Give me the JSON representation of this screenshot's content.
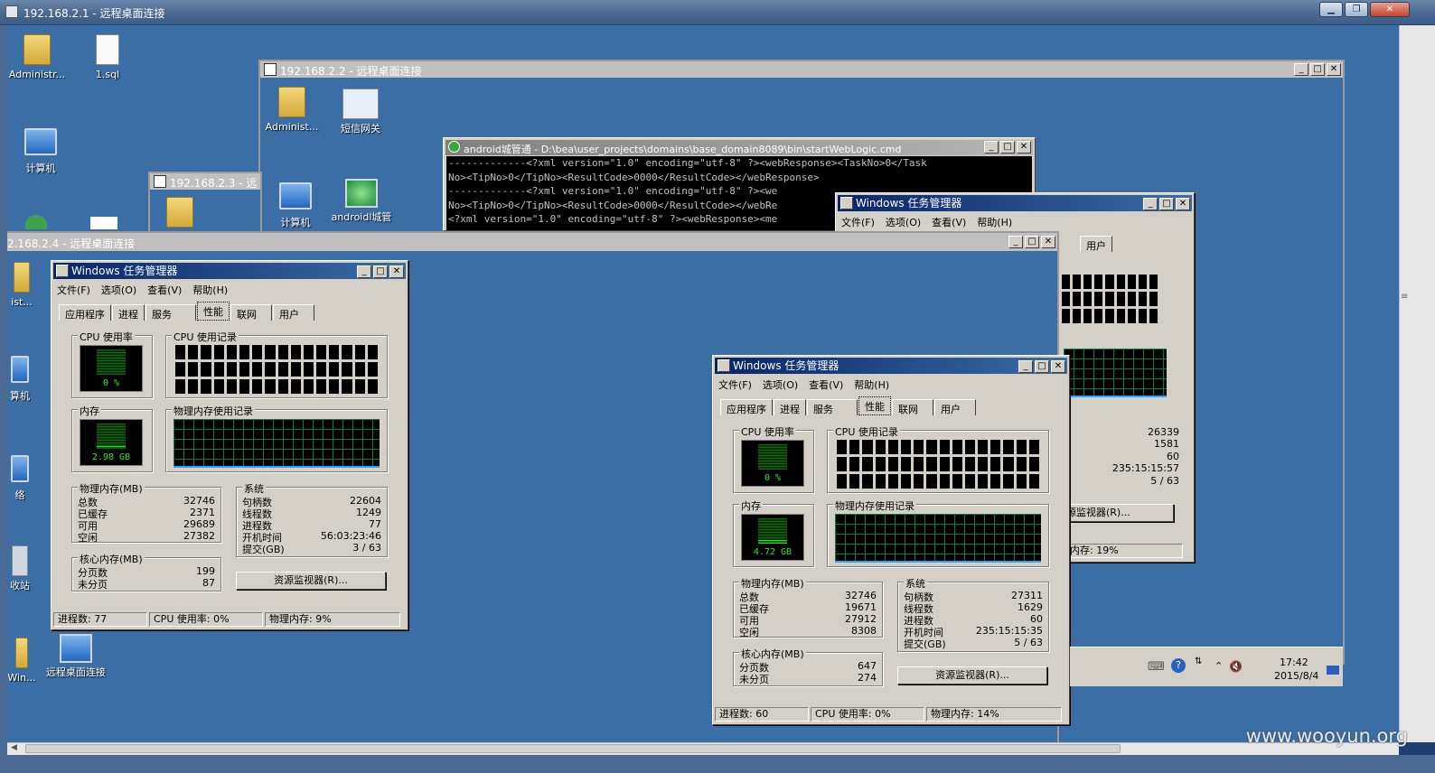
{
  "outer": {
    "title": "192.168.2.1 - 远程桌面连接"
  },
  "desktop": {
    "icons": [
      {
        "label": "Administr..."
      },
      {
        "label": "1.sql"
      },
      {
        "label": "计算机"
      },
      {
        "label": "ist..."
      },
      {
        "label": "算机"
      },
      {
        "label": "络"
      },
      {
        "label": "收站"
      },
      {
        "label": "Win..."
      },
      {
        "label": "远程桌面连接"
      }
    ]
  },
  "rdp22": {
    "title": "192.168.2.2 - 远程桌面连接",
    "icons": [
      {
        "label": "Administ..."
      },
      {
        "label": "短信网关"
      },
      {
        "label": "计算机"
      },
      {
        "label": "androidl城管"
      }
    ]
  },
  "rdp23": {
    "title": "192.168.2.3 - 远"
  },
  "rdp24": {
    "title": "2.168.2.4 - 远程桌面连接"
  },
  "cmd": {
    "title": "android城管通 - D:\\bea\\user_projects\\domains\\base_domain8089\\bin\\startWebLogic.cmd",
    "lines": [
      "-------------<?xml version=\"1.0\" encoding=\"utf-8\" ?><webResponse><TaskNo>0</Task",
      "No><TipNo>0</TipNo><ResultCode>0000</ResultCode></webResponse>",
      "-------------<?xml version=\"1.0\" encoding=\"utf-8\" ?><we",
      "No><TipNo>0</TipNo><ResultCode>0000</ResultCode></webRe",
      "<?xml version=\"1.0\" encoding=\"utf-8\" ?><webResponse><me"
    ]
  },
  "tm": {
    "title": "Windows 任务管理器",
    "menu": [
      "文件(F)",
      "选项(O)",
      "查看(V)",
      "帮助(H)"
    ],
    "tabs": [
      "应用程序",
      "进程",
      "服务",
      "性能",
      "联网",
      "用户"
    ],
    "labels": {
      "cpu_usage": "CPU 使用率",
      "cpu_history": "CPU 使用记录",
      "memory": "内存",
      "phys_history": "物理内存使用记录",
      "phys_mem": "物理内存(MB)",
      "total": "总数",
      "cached": "已缓存",
      "available": "可用",
      "free": "空闲",
      "system": "系统",
      "handles": "句柄数",
      "threads": "线程数",
      "processes": "进程数",
      "uptime": "开机时间",
      "commit": "提交(GB)",
      "kernel": "核心内存(MB)",
      "paged": "分页数",
      "nonpaged": "未分页",
      "resmon": "资源监视器(R)..."
    }
  },
  "tm1": {
    "cpu": "0 %",
    "mem": "2.98 GB",
    "cpu_level": 0.0,
    "mem_level": 0.09,
    "total": "32746",
    "cached": "2371",
    "available": "29689",
    "free": "27382",
    "handles": "22604",
    "threads": "1249",
    "processes": "77",
    "uptime": "56:03:23:46",
    "commit": "3 / 63",
    "paged": "199",
    "nonpaged": "87",
    "status_proc": "进程数: 77",
    "status_cpu": "CPU 使用率: 0%",
    "status_mem": "物理内存: 9%"
  },
  "tm2": {
    "cpu": "0 %",
    "mem": "4.72 GB",
    "cpu_level": 0.0,
    "mem_level": 0.14,
    "total": "32746",
    "cached": "19671",
    "available": "27912",
    "free": "8308",
    "handles": "27311",
    "threads": "1629",
    "processes": "60",
    "uptime": "235:15:15:35",
    "commit": "5 / 63",
    "paged": "647",
    "nonpaged": "274",
    "status_proc": "进程数: 60",
    "status_cpu": "CPU 使用率: 0%",
    "status_mem": "物理内存: 14%"
  },
  "tm3": {
    "tab_partial": "用户",
    "handles": "26339",
    "threads": "1581",
    "processes": "60",
    "uptime": "235:15:15:57",
    "commit": "5 / 63",
    "resmon": "源监视器(R)...",
    "status_mem": "内存: 19%"
  },
  "tray": {
    "time": "17:42",
    "date": "2015/8/4"
  },
  "watermark": "www.wooyun.org"
}
